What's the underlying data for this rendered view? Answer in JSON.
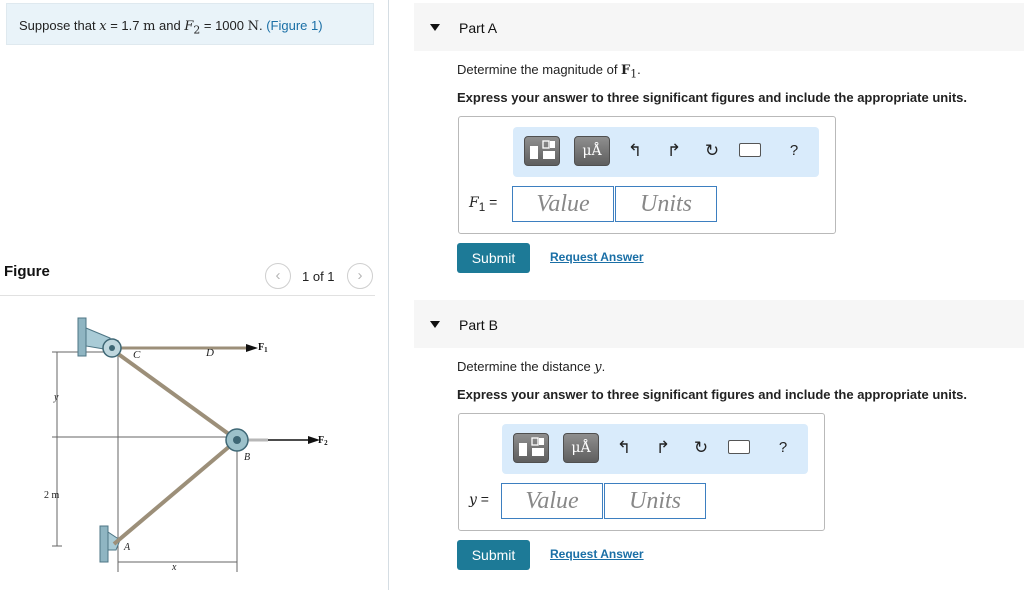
{
  "problem": {
    "text_pre": "Suppose that ",
    "x_var": "x",
    "eq1": " = 1.7 ",
    "unit_m": "m",
    "and": " and ",
    "f2_var": "F",
    "f2_sub": "2",
    "eq2": " = 1000 ",
    "unit_n": "N",
    "period": ". ",
    "figure_link": "(Figure 1)"
  },
  "figure": {
    "heading": "Figure",
    "pager_text": "1 of 1",
    "prev_icon": "chevron-left-icon",
    "next_icon": "chevron-right-icon",
    "labels": {
      "C": "C",
      "D": "D",
      "B": "B",
      "A": "A",
      "F1": "F",
      "F1_sub": "1",
      "F2": "F",
      "F2_sub": "2",
      "y": "y",
      "two_m": "2 m",
      "x": "x"
    }
  },
  "partA": {
    "title": "Part A",
    "prompt_pre": "Determine the magnitude of ",
    "prompt_var": "F",
    "prompt_sub": "1",
    "prompt_post": ".",
    "instruction": "Express your answer to three significant figures and include the appropriate units.",
    "var_label": "F",
    "var_sub": "1",
    "var_eq": " =",
    "value_placeholder": "Value",
    "units_placeholder": "Units",
    "units_button": "μÅ",
    "help": "?",
    "submit": "Submit",
    "request": "Request Answer"
  },
  "partB": {
    "title": "Part B",
    "prompt_pre": "Determine the distance ",
    "prompt_var": "y",
    "prompt_post": ".",
    "instruction": "Express your answer to three significant figures and include the appropriate units.",
    "var_label": "y",
    "var_eq": " =",
    "value_placeholder": "Value",
    "units_placeholder": "Units",
    "units_button": "μÅ",
    "help": "?",
    "submit": "Submit",
    "request": "Request Answer"
  },
  "colors": {
    "problem_bg": "#e9f3f9",
    "toolbar_bg": "#d9ebfb",
    "submit_bg": "#1d7a97",
    "link": "#1a6fa6",
    "field_border": "#3d7fc0"
  }
}
